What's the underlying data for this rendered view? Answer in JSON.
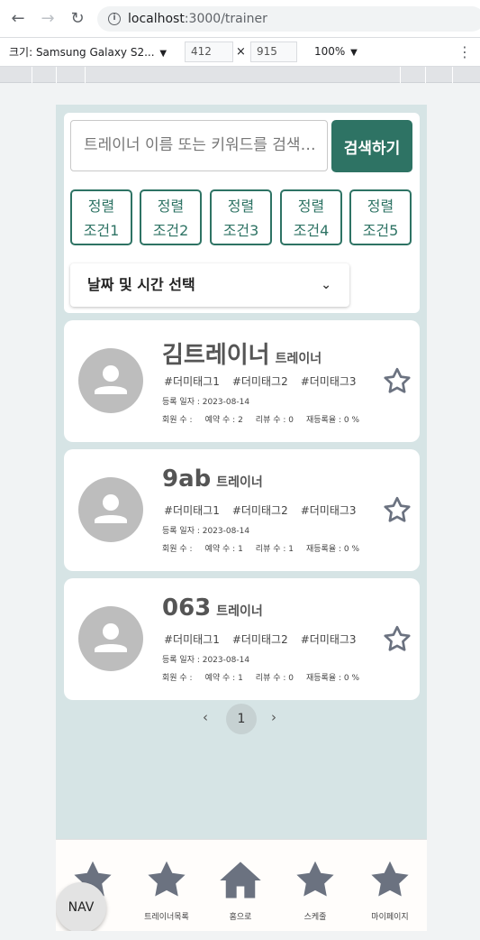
{
  "browser": {
    "host": "localhost",
    "path": ":3000/trainer",
    "device": "크기: Samsung Galaxy S2...",
    "width": "412",
    "height": "915",
    "times": "×",
    "zoom": "100%"
  },
  "search": {
    "placeholder": "트레이너 이름 또는 키워드를 검색해보세요",
    "button_label": "검색하기"
  },
  "sort_buttons": [
    {
      "line1": "정렬",
      "line2": "조건1"
    },
    {
      "line1": "정렬",
      "line2": "조건2"
    },
    {
      "line1": "정렬",
      "line2": "조건3"
    },
    {
      "line1": "정렬",
      "line2": "조건4"
    },
    {
      "line1": "정렬",
      "line2": "조건5"
    }
  ],
  "date_select": {
    "label": "날짜 및 시간 선택"
  },
  "trainers": [
    {
      "name": "김트레이너",
      "role": "트레이너",
      "tags": [
        "#더미태그1",
        "#더미태그2",
        "#더미태그3"
      ],
      "registered": "등록 일자 : 2023-08-14",
      "members": "회원 수 :",
      "reservations": "예약 수 : 2",
      "reviews": "리뷰 수 : 0",
      "rebook": "재등록율 : 0 %"
    },
    {
      "name": "9ab",
      "role": "트레이너",
      "tags": [
        "#더미태그1",
        "#더미태그2",
        "#더미태그3"
      ],
      "registered": "등록 일자 : 2023-08-14",
      "members": "회원 수 :",
      "reservations": "예약 수 : 1",
      "reviews": "리뷰 수 : 1",
      "rebook": "재등록율 : 0 %"
    },
    {
      "name": "063",
      "role": "트레이너",
      "tags": [
        "#더미태그1",
        "#더미태그2",
        "#더미태그3"
      ],
      "registered": "등록 일자 : 2023-08-14",
      "members": "회원 수 :",
      "reservations": "예약 수 : 1",
      "reviews": "리뷰 수 : 0",
      "rebook": "재등록율 : 0 %"
    }
  ],
  "pagination": {
    "prev": "‹",
    "current": "1",
    "next": "›"
  },
  "bottom_nav": {
    "items": [
      {
        "label": "…",
        "icon": "star-icon"
      },
      {
        "label": "트레이너목록",
        "icon": "star-icon"
      },
      {
        "label": "홈으로",
        "icon": "home-icon"
      },
      {
        "label": "스케줄",
        "icon": "star-icon"
      },
      {
        "label": "마이페이지",
        "icon": "star-icon"
      }
    ],
    "fab_label": "NAV"
  },
  "colors": {
    "accent": "#2e7364",
    "background": "#d6e4e5",
    "icon": "#6b7280",
    "avatar": "#bdbdbd"
  }
}
